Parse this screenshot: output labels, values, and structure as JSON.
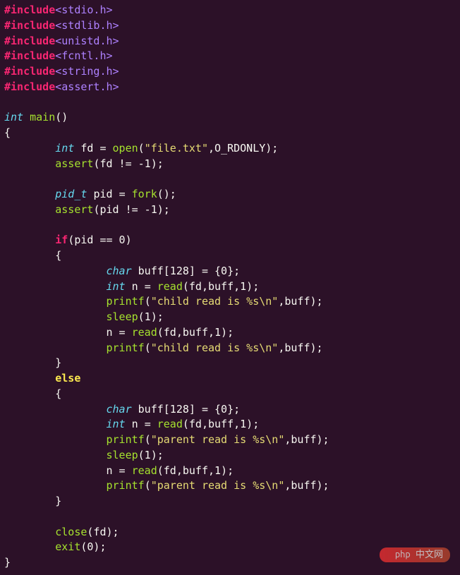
{
  "includes": [
    "<stdio.h>",
    "<stdlib.h>",
    "<unistd.h>",
    "<fcntl.h>",
    "<string.h>",
    "<assert.h>"
  ],
  "sig_ret": "int",
  "sig_name": "main",
  "sig_args": "()",
  "fd_decl_type": "int",
  "fd_decl_name": "fd",
  "open_fn": "open",
  "open_file": "\"file.txt\"",
  "open_flag": "O_RDONLY",
  "assert1": "assert",
  "assert1_expr": "(fd != -1);",
  "pid_type": "pid_t",
  "pid_name": "pid",
  "fork_fn": "fork",
  "assert2": "assert",
  "assert2_expr": "(pid != -1);",
  "if_kw": "if",
  "if_cond": "(pid == 0)",
  "buff_type": "char",
  "buff_decl": "buff[128] = {0};",
  "n_type": "int",
  "n_name": "n",
  "read_fn": "read",
  "read_args": "(fd,buff,1);",
  "printf_fn": "printf",
  "child_fmt": "\"child read is %s\\n\"",
  "parent_fmt": "\"parent read is %s\\n\"",
  "printf_tail": ",buff);",
  "sleep_fn": "sleep",
  "sleep_arg": "(1);",
  "n_reassign": "n = ",
  "else_kw": "else",
  "close_fn": "close",
  "close_arg": "(fd);",
  "exit_fn": "exit",
  "exit_arg": "(0);",
  "watermark": "php 中文网"
}
